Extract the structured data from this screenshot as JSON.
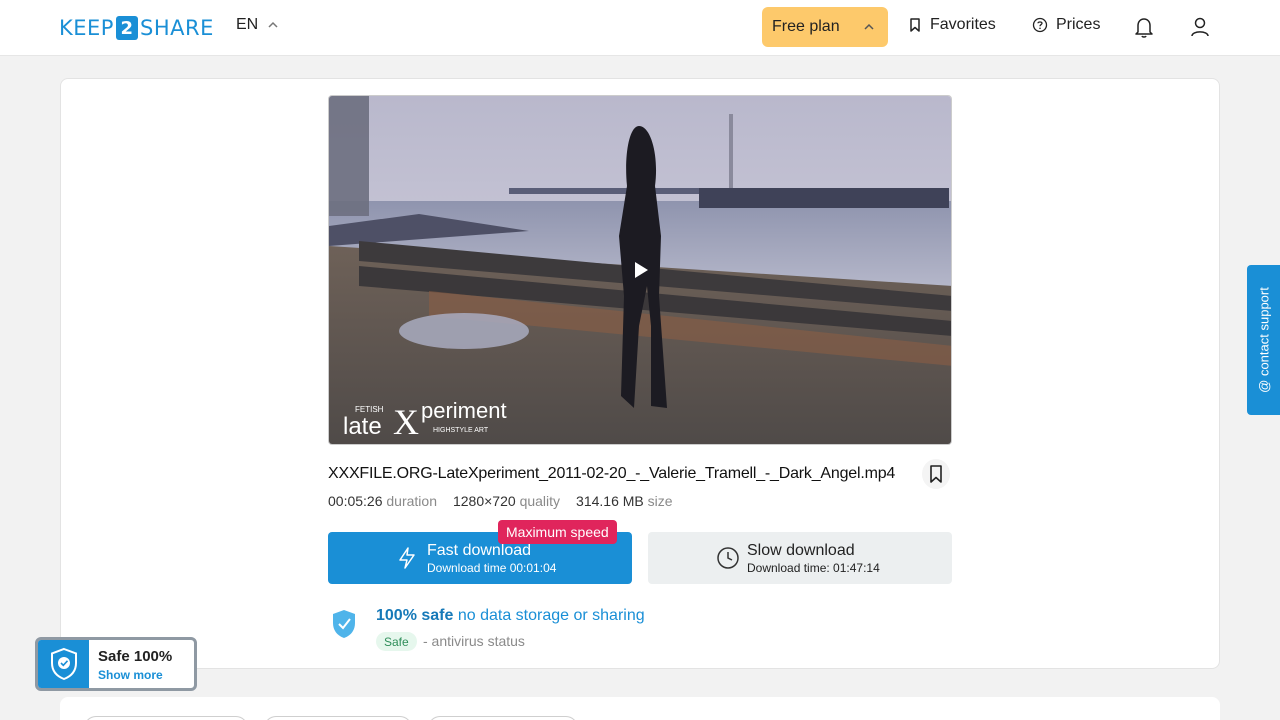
{
  "header": {
    "logo_left": "KEEP",
    "logo_num": "2",
    "logo_right": "SHARE",
    "language": "EN",
    "plan_label": "Free plan",
    "favorites_label": "Favorites",
    "prices_label": "Prices"
  },
  "video": {
    "watermark_small": "FETISH",
    "watermark_main_1": "late",
    "watermark_main_2": "X",
    "watermark_main_3": "periment",
    "watermark_sub": "HIGHSTYLE ART"
  },
  "file": {
    "name": "XXXFILE.ORG-LateXperiment_2011-02-20_-_Valerie_Tramell_-_Dark_Angel.mp4",
    "duration_value": "00:05:26",
    "duration_label": "duration",
    "quality_value": "1280×720",
    "quality_label": "quality",
    "size_value": "314.16 MB",
    "size_label": "size"
  },
  "downloads": {
    "max_badge": "Maximum speed",
    "fast_title": "Fast download",
    "fast_time": "Download time 00:01:04",
    "slow_title": "Slow download",
    "slow_time": "Download time: 01:47:14"
  },
  "safety": {
    "title_bold": "100% safe",
    "title_rest": " no data storage or sharing",
    "tag": "Safe",
    "status": "- antivirus status"
  },
  "contact": {
    "label": "@ contact support"
  },
  "safe_widget": {
    "title": "Safe 100%",
    "link": "Show more"
  },
  "colors": {
    "brand": "#1a8fd6",
    "plan": "#fdc96b",
    "badge": "#e0255c"
  }
}
